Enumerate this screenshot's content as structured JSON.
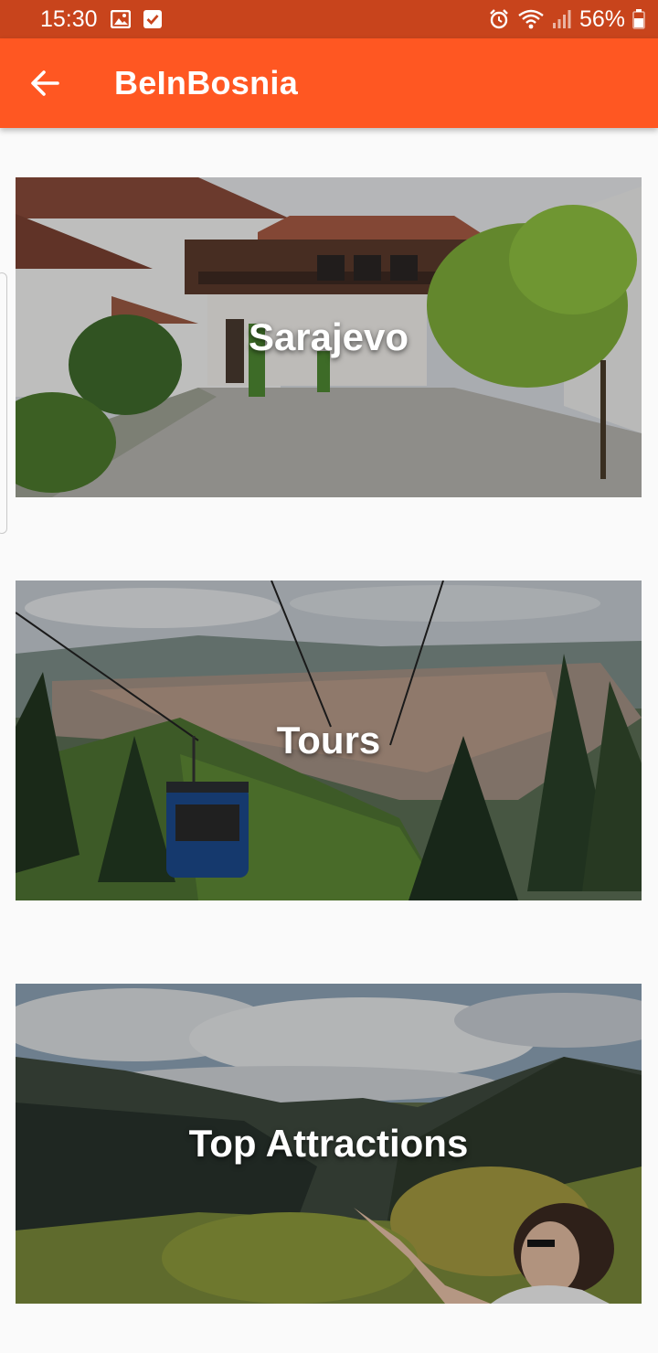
{
  "status_bar": {
    "time": "15:30",
    "battery": "56%",
    "left_icons": [
      "image-icon",
      "check-box-icon"
    ],
    "right_icons": [
      "alarm-icon",
      "wifi-icon",
      "signal-icon",
      "battery-icon"
    ]
  },
  "app_bar": {
    "back_icon": "arrow-back-icon",
    "title": "BeInBosnia",
    "color": "#ff5722"
  },
  "cards": [
    {
      "label": "Sarajevo",
      "image": "courtyard-photo"
    },
    {
      "label": "Tours",
      "image": "cable-car-photo"
    },
    {
      "label": "Top Attractions",
      "image": "mountain-view-photo"
    }
  ]
}
